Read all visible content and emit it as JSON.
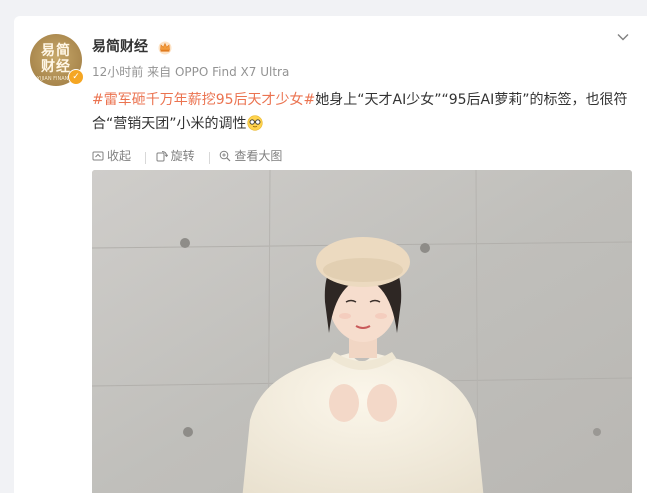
{
  "post": {
    "author": {
      "avatar_line1": "易简",
      "avatar_line2": "财经",
      "avatar_small": "YIJIAN FINANCE",
      "name": "易简财经",
      "verified_mark": "✓"
    },
    "time": "12小时前",
    "source_prefix": "来自",
    "device": "OPPO Find X7 Ultra",
    "text": {
      "hashtag": "#雷军砸千万年薪挖95后天才少女#",
      "body": "她身上“天才AI少女”“95后AI萝莉”的标签，也很符合“营销天团”小米的调性"
    },
    "toolbar": {
      "collect": "收起",
      "rotate": "旋转",
      "view_large": "查看大图"
    }
  },
  "colors": {
    "accent_link": "#eb7350",
    "verify_badge": "#f5a623",
    "page_bg": "#f1f2f5"
  },
  "icons": [
    "crown-icon",
    "chevron-down-icon",
    "collapse-icon",
    "rotate-icon",
    "zoom-icon",
    "emoji-glasses-icon"
  ]
}
